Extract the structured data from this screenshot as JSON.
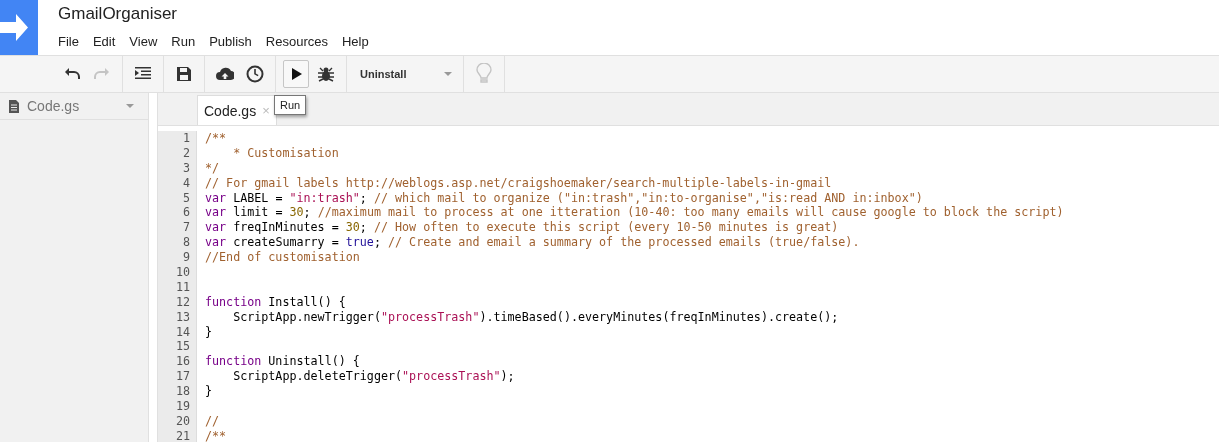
{
  "app": {
    "title": "GmailOrganiser"
  },
  "menu": [
    "File",
    "Edit",
    "View",
    "Run",
    "Publish",
    "Resources",
    "Help"
  ],
  "toolbar": {
    "groups": [
      [
        {
          "kind": "undo",
          "disabled": false
        },
        {
          "kind": "redo",
          "disabled": true
        }
      ],
      [
        {
          "kind": "indent",
          "disabled": false
        }
      ],
      [
        {
          "kind": "save",
          "disabled": false
        }
      ],
      [
        {
          "kind": "upload",
          "disabled": false
        },
        {
          "kind": "clock",
          "disabled": false
        }
      ],
      [
        {
          "kind": "run",
          "disabled": false,
          "selected": true
        },
        {
          "kind": "bug",
          "disabled": false,
          "selected": false
        }
      ]
    ],
    "function_select": "Uninstall",
    "hint_disabled": true
  },
  "tooltip": "Run",
  "sidebar": {
    "items": [
      {
        "label": "Code.gs"
      }
    ]
  },
  "tabs": [
    {
      "label": "Code.gs",
      "selected": true,
      "close": "×"
    }
  ],
  "code": [
    {
      "number": "1",
      "tokens": [
        {
          "kind": "comment",
          "text": "/**"
        }
      ]
    },
    {
      "number": "2",
      "tokens": [
        {
          "kind": "comment",
          "text": "    * Customisation"
        }
      ]
    },
    {
      "number": "3",
      "tokens": [
        {
          "kind": "comment",
          "text": "*/"
        }
      ]
    },
    {
      "number": "4",
      "tokens": [
        {
          "kind": "comment",
          "text": "// For gmail labels http://weblogs.asp.net/craigshoemaker/search-multiple-labels-in-gmail"
        }
      ]
    },
    {
      "number": "5",
      "tokens": [
        {
          "kind": "keyword",
          "text": "var"
        },
        {
          "kind": "plain",
          "text": " LABEL = "
        },
        {
          "kind": "string",
          "text": "\"in:trash\""
        },
        {
          "kind": "plain",
          "text": "; "
        },
        {
          "kind": "comment",
          "text": "// which mail to organize (\"in:trash\",\"in:to-organise\",\"is:read AND in:inbox\")"
        }
      ]
    },
    {
      "number": "6",
      "tokens": [
        {
          "kind": "keyword",
          "text": "var"
        },
        {
          "kind": "plain",
          "text": " limit = "
        },
        {
          "kind": "number",
          "text": "30"
        },
        {
          "kind": "plain",
          "text": "; "
        },
        {
          "kind": "comment",
          "text": "//maximum mail to process at one itteration (10-40: too many emails will cause google to block the script)"
        }
      ]
    },
    {
      "number": "7",
      "tokens": [
        {
          "kind": "keyword",
          "text": "var"
        },
        {
          "kind": "plain",
          "text": " freqInMinutes = "
        },
        {
          "kind": "number",
          "text": "30"
        },
        {
          "kind": "plain",
          "text": "; "
        },
        {
          "kind": "comment",
          "text": "// How often to execute this script (every 10-50 minutes is great)"
        }
      ]
    },
    {
      "number": "8",
      "tokens": [
        {
          "kind": "keyword",
          "text": "var"
        },
        {
          "kind": "plain",
          "text": " createSumarry = "
        },
        {
          "kind": "atom",
          "text": "true"
        },
        {
          "kind": "plain",
          "text": "; "
        },
        {
          "kind": "comment",
          "text": "// Create and email a summary of the processed emails (true/false)."
        }
      ]
    },
    {
      "number": "9",
      "tokens": [
        {
          "kind": "comment",
          "text": "//End of customisation"
        }
      ]
    },
    {
      "number": "10"
    },
    {
      "number": "11"
    },
    {
      "number": "12",
      "tokens": [
        {
          "kind": "keyword",
          "text": "function"
        },
        {
          "kind": "plain",
          "text": " Install() {"
        }
      ]
    },
    {
      "number": "13",
      "tokens": [
        {
          "kind": "plain",
          "text": "    ScriptApp.newTrigger("
        },
        {
          "kind": "string",
          "text": "\"processTrash\""
        },
        {
          "kind": "plain",
          "text": ").timeBased().everyMinutes(freqInMinutes).create();"
        }
      ]
    },
    {
      "number": "14",
      "tokens": [
        {
          "kind": "plain",
          "text": "}"
        }
      ]
    },
    {
      "number": "15"
    },
    {
      "number": "16",
      "tokens": [
        {
          "kind": "keyword",
          "text": "function"
        },
        {
          "kind": "plain",
          "text": " Uninstall() {"
        }
      ]
    },
    {
      "number": "17",
      "tokens": [
        {
          "kind": "plain",
          "text": "    ScriptApp.deleteTrigger("
        },
        {
          "kind": "string",
          "text": "\"processTrash\""
        },
        {
          "kind": "plain",
          "text": ");"
        }
      ]
    },
    {
      "number": "18",
      "tokens": [
        {
          "kind": "plain",
          "text": "}"
        }
      ]
    },
    {
      "number": "19"
    },
    {
      "number": "20",
      "tokens": [
        {
          "kind": "comment",
          "text": "//"
        }
      ]
    },
    {
      "number": "21",
      "tokens": [
        {
          "kind": "comment",
          "text": "/**"
        }
      ]
    }
  ]
}
